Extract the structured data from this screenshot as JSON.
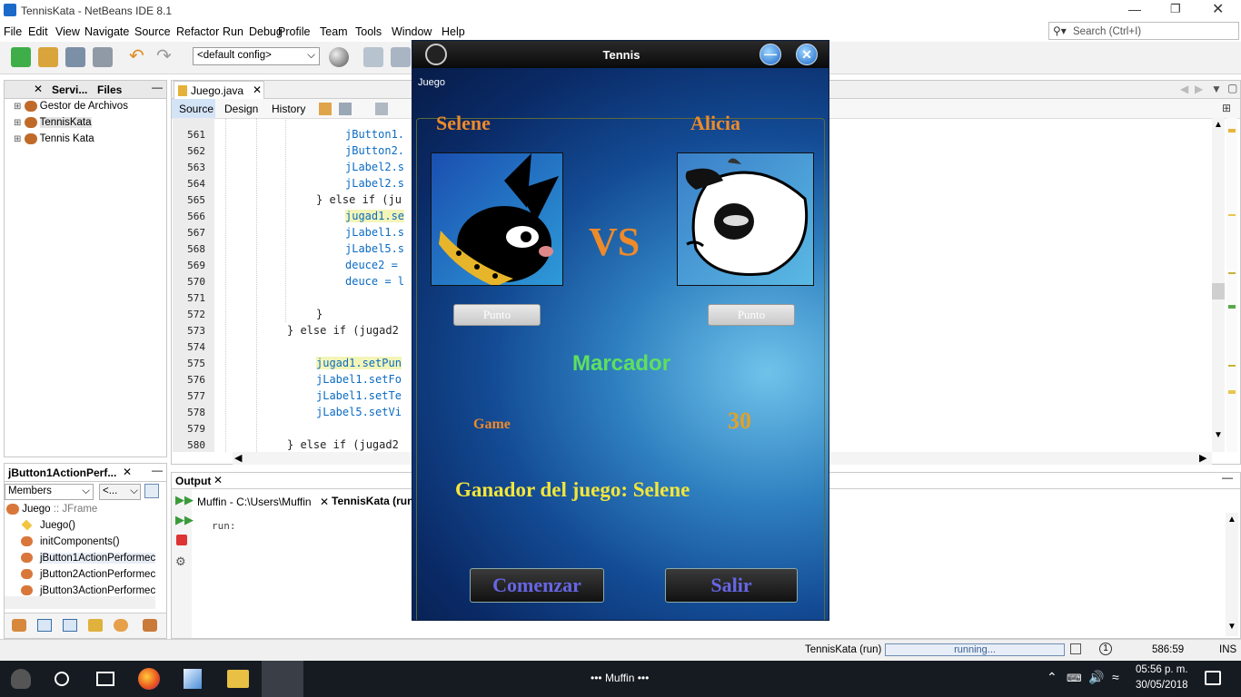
{
  "window": {
    "title": "TennisKata - NetBeans IDE 8.1"
  },
  "menu": [
    "File",
    "Edit",
    "View",
    "Navigate",
    "Source",
    "Refactor",
    "Run",
    "Debug",
    "Profile",
    "Team",
    "Tools",
    "Window",
    "Help"
  ],
  "toolbar": {
    "config": "<default config>"
  },
  "search": {
    "placeholder": "Search (Ctrl+I)"
  },
  "projects": {
    "tabs": [
      "Servi...",
      "Files"
    ],
    "items": [
      "Gestor de Archivos",
      "TennisKata",
      "Tennis Kata"
    ]
  },
  "navigator": {
    "title": "jButton1ActionPerf...",
    "filter": "Members",
    "filter2": "<...",
    "root": "Juego",
    "root_type": ":: JFrame",
    "members": [
      "Juego()",
      "initComponents()",
      "jButton1ActionPerformec",
      "jButton2ActionPerformec",
      "jButton3ActionPerformec"
    ]
  },
  "editor": {
    "tab": "Juego.java",
    "subtabs": [
      "Source",
      "Design",
      "History"
    ],
    "lines": [
      {
        "n": "561",
        "code": "jButton1."
      },
      {
        "n": "562",
        "code": "jButton2."
      },
      {
        "n": "563",
        "code": "jLabel2.s"
      },
      {
        "n": "564",
        "code": "jLabel2.s"
      },
      {
        "n": "565",
        "code": "} else if (ju"
      },
      {
        "n": "566",
        "code": "jugad1.se"
      },
      {
        "n": "567",
        "code": "jLabel1.s"
      },
      {
        "n": "568",
        "code": "jLabel5.s"
      },
      {
        "n": "569",
        "code": "deuce2 ="
      },
      {
        "n": "570",
        "code": "deuce = l"
      },
      {
        "n": "571",
        "code": ""
      },
      {
        "n": "572",
        "code": "}"
      },
      {
        "n": "573",
        "code": "} else if (jugad2"
      },
      {
        "n": "574",
        "code": ""
      },
      {
        "n": "575",
        "code": "jugad1.setPun"
      },
      {
        "n": "576",
        "code": "jLabel1.setFo"
      },
      {
        "n": "577",
        "code": "jLabel1.setTe"
      },
      {
        "n": "578",
        "code": "jLabel5.setVi"
      },
      {
        "n": "579",
        "code": ""
      },
      {
        "n": "580",
        "code": "} else if (jugad2"
      }
    ]
  },
  "output": {
    "title": "Output",
    "tabs": [
      "Muffin - C:\\Users\\Muffin",
      "TennisKata (run"
    ],
    "text": "run:"
  },
  "statusbar": {
    "task": "TennisKata (run)",
    "progress": "running...",
    "position": "586:59",
    "mode": "INS"
  },
  "dialog": {
    "title": "Tennis",
    "label": "Juego",
    "player1": "Selene",
    "player2": "Alicia",
    "vs": "VS",
    "punto1": "Punto",
    "punto2": "Punto",
    "marcador": "Marcador",
    "game_label": "Game",
    "score": "30",
    "winner": "Ganador del juego: Selene",
    "start": "Comenzar",
    "exit": "Salir"
  },
  "taskbar": {
    "app": "••• Muffin •••",
    "time": "05:56 p. m.",
    "date": "30/05/2018"
  }
}
